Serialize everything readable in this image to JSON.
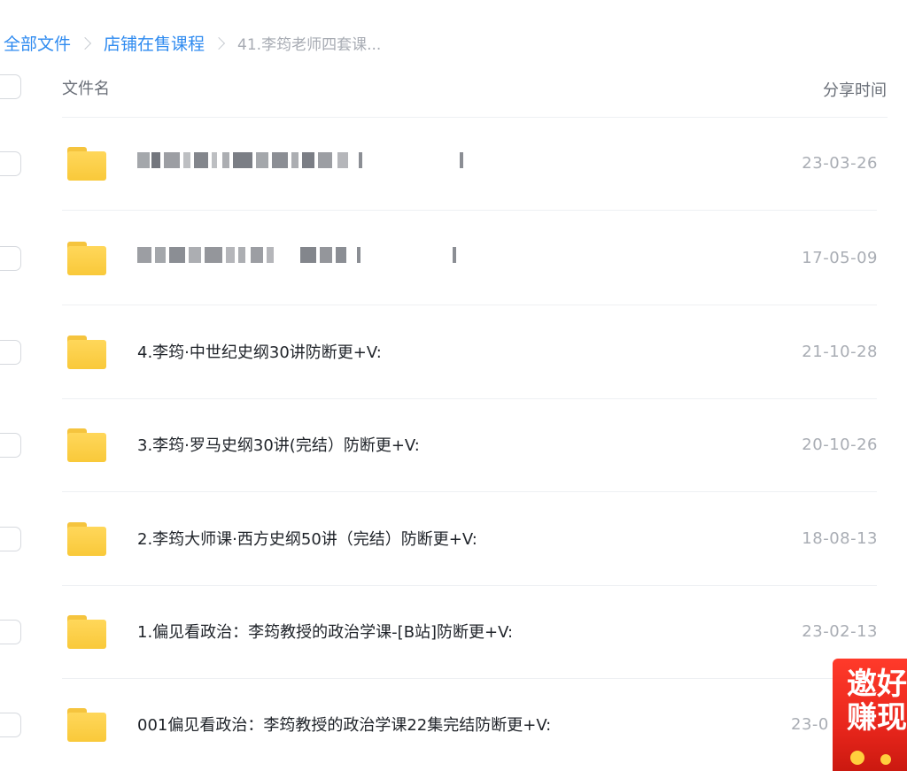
{
  "breadcrumb": {
    "items": [
      "全部文件",
      "店铺在售课程"
    ],
    "current": "41.李筠老师四套课..."
  },
  "header": {
    "name_label": "文件名",
    "time_label": "分享时间"
  },
  "files": [
    {
      "name": "",
      "date": "23-03-26",
      "redacted": true
    },
    {
      "name": "",
      "date": "17-05-09",
      "redacted": true
    },
    {
      "name": "4.李筠·中世纪史纲30讲防断更+V:",
      "date": "21-10-28"
    },
    {
      "name": "3.李筠·罗马史纲30讲(完结）防断更+V:",
      "date": "20-10-26"
    },
    {
      "name": "2.李筠大师课·西方史纲50讲（完结）防断更+V:",
      "date": "18-08-13"
    },
    {
      "name": "1.偏见看政治：李筠教授的政治学课-[B站]防断更+V:",
      "date": "23-02-13"
    },
    {
      "name": "001偏见看政治：李筠教授的政治学课22集完结防断更+V:",
      "date": "23-0"
    }
  ],
  "promo": {
    "line1": "邀好",
    "line2": "赚现"
  },
  "colors": {
    "link": "#2f8bf0",
    "folder": "#f9c93a",
    "promo": "#e8261c"
  },
  "icons": {
    "folder": "folder-icon",
    "breadcrumb_separator": "chevron-right-icon"
  }
}
